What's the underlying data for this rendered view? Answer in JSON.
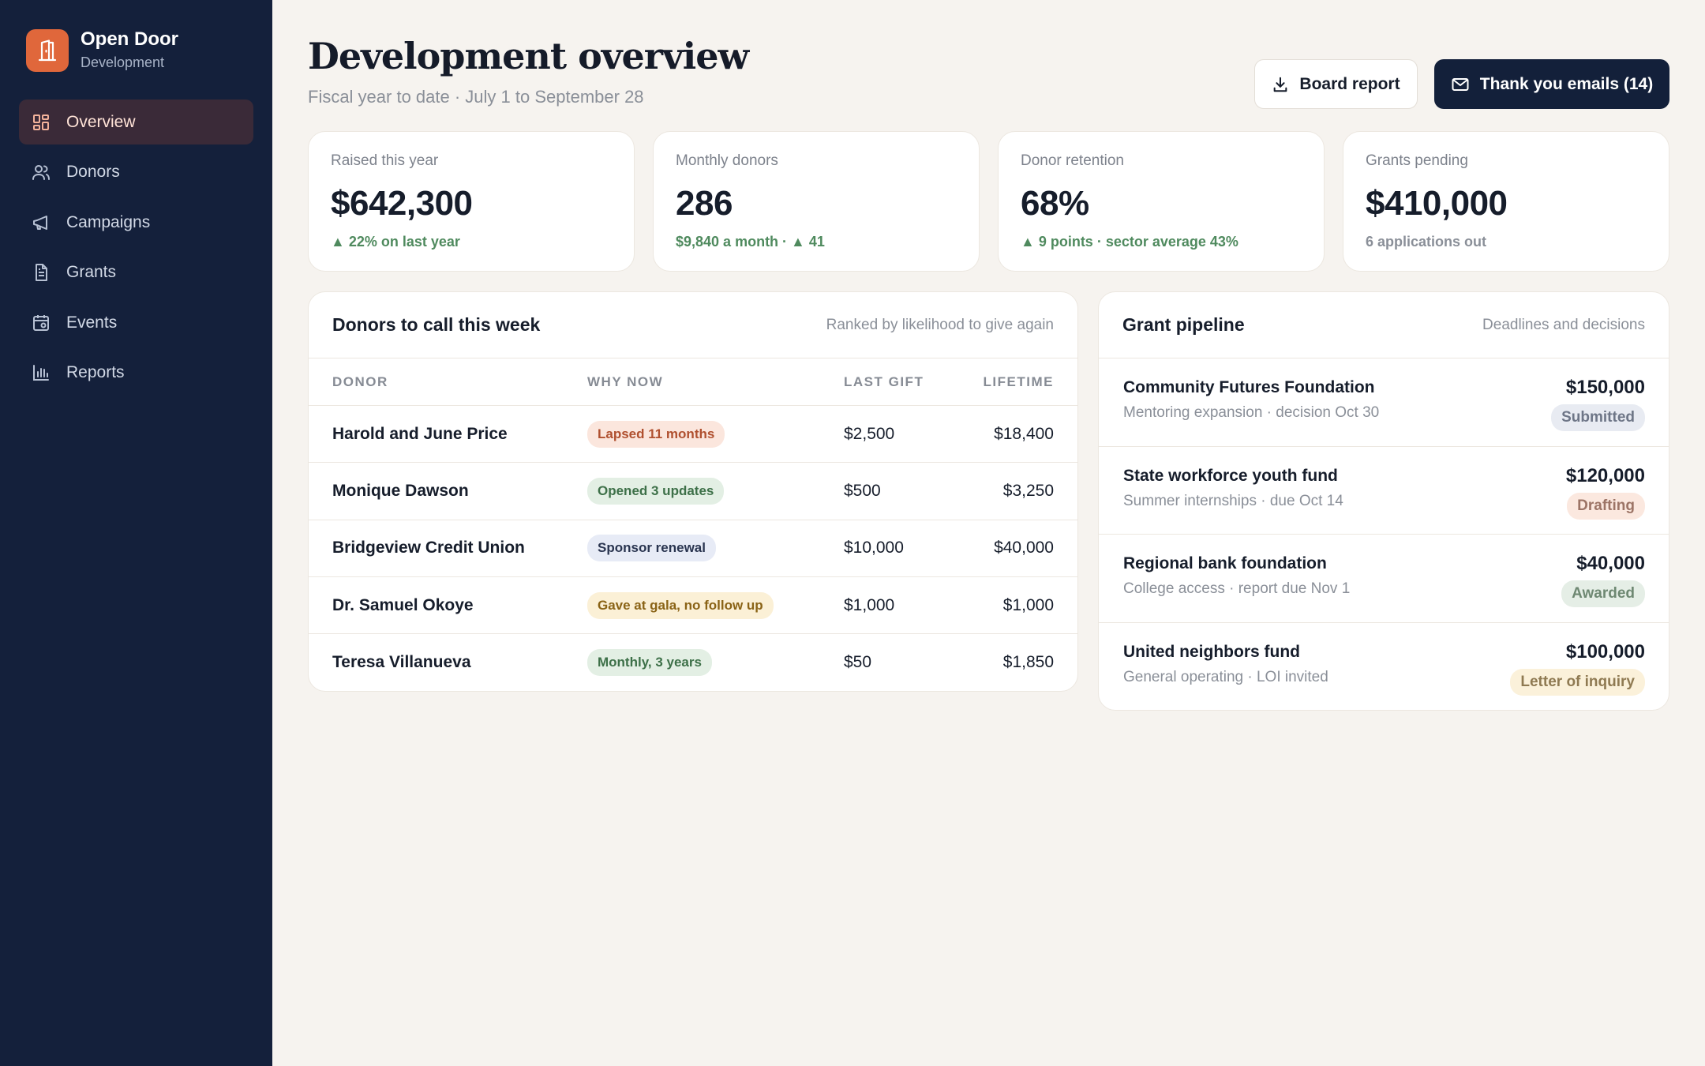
{
  "app": {
    "name": "Open Door",
    "subtitle": "Development"
  },
  "sidebar": {
    "items": [
      {
        "label": "Overview",
        "icon": "grid-icon",
        "active": true
      },
      {
        "label": "Donors",
        "icon": "users-icon"
      },
      {
        "label": "Campaigns",
        "icon": "megaphone-icon"
      },
      {
        "label": "Grants",
        "icon": "document-icon"
      },
      {
        "label": "Events",
        "icon": "calendar-icon"
      },
      {
        "label": "Reports",
        "icon": "bar-chart-icon"
      }
    ]
  },
  "header": {
    "title": "Development overview",
    "subtitle": "Fiscal year to date · July 1 to September 28",
    "board_report_label": "Board report",
    "thank_you_label": "Thank you emails (14)"
  },
  "stats": [
    {
      "label": "Raised this year",
      "value": "$642,300",
      "delta": "▲ 22% on last year",
      "tone": "green"
    },
    {
      "label": "Monthly donors",
      "value": "286",
      "delta": "$9,840 a month · ▲ 41",
      "tone": "green"
    },
    {
      "label": "Donor retention",
      "value": "68%",
      "delta": "▲ 9 points · sector average 43%",
      "tone": "green"
    },
    {
      "label": "Grants pending",
      "value": "$410,000",
      "delta": "6 applications out",
      "tone": "grey"
    }
  ],
  "donors_panel": {
    "title": "Donors to call this week",
    "note": "Ranked by likelihood to give again",
    "columns": {
      "donor": "DONOR",
      "why": "WHY NOW",
      "last": "LAST GIFT",
      "lifetime": "LIFETIME"
    },
    "rows": [
      {
        "donor": "Harold and June Price",
        "why": "Lapsed 11 months",
        "last": "$2,500",
        "lifetime": "$18,400",
        "tag_bg": "#fbe6dd",
        "tag_fg": "#b0502f"
      },
      {
        "donor": "Monique Dawson",
        "why": "Opened 3 updates",
        "last": "$500",
        "lifetime": "$3,250",
        "tag_bg": "#e3efe4",
        "tag_fg": "#3d7048"
      },
      {
        "donor": "Bridgeview Credit Union",
        "why": "Sponsor renewal",
        "last": "$10,000",
        "lifetime": "$40,000",
        "tag_bg": "#e7ebf6",
        "tag_fg": "#2a3550"
      },
      {
        "donor": "Dr. Samuel Okoye",
        "why": "Gave at gala, no follow up",
        "last": "$1,000",
        "lifetime": "$1,000",
        "tag_bg": "#fbf0d6",
        "tag_fg": "#8a6316"
      },
      {
        "donor": "Teresa Villanueva",
        "why": "Monthly, 3 years",
        "last": "$50",
        "lifetime": "$1,850",
        "tag_bg": "#e3efe4",
        "tag_fg": "#3d7048"
      }
    ]
  },
  "pipeline_panel": {
    "title": "Grant pipeline",
    "note": "Deadlines and decisions",
    "grants": [
      {
        "name": "Community Futures Foundation",
        "desc": "Mentoring expansion · decision Oct 30",
        "amount": "$150,000",
        "status": "Submitted",
        "status_bg": "#e8ebf2",
        "status_fg": "#6e7687"
      },
      {
        "name": "State workforce youth fund",
        "desc": "Summer internships · due Oct 14",
        "amount": "$120,000",
        "status": "Drafting",
        "status_bg": "#fbe8df",
        "status_fg": "#9c7466"
      },
      {
        "name": "Regional bank foundation",
        "desc": "College access · report due Nov 1",
        "amount": "$40,000",
        "status": "Awarded",
        "status_bg": "#e5eee6",
        "status_fg": "#6e8872"
      },
      {
        "name": "United neighbors fund",
        "desc": "General operating · LOI invited",
        "amount": "$100,000",
        "status": "Letter of inquiry",
        "status_bg": "#fbf1da",
        "status_fg": "#8f7a52"
      }
    ]
  },
  "colors": {
    "sidebar_bg": "#14203b",
    "accent": "#e0673b",
    "primary_button": "#13203a",
    "positive": "#4f8a5e",
    "page_bg": "#f6f3ef"
  }
}
